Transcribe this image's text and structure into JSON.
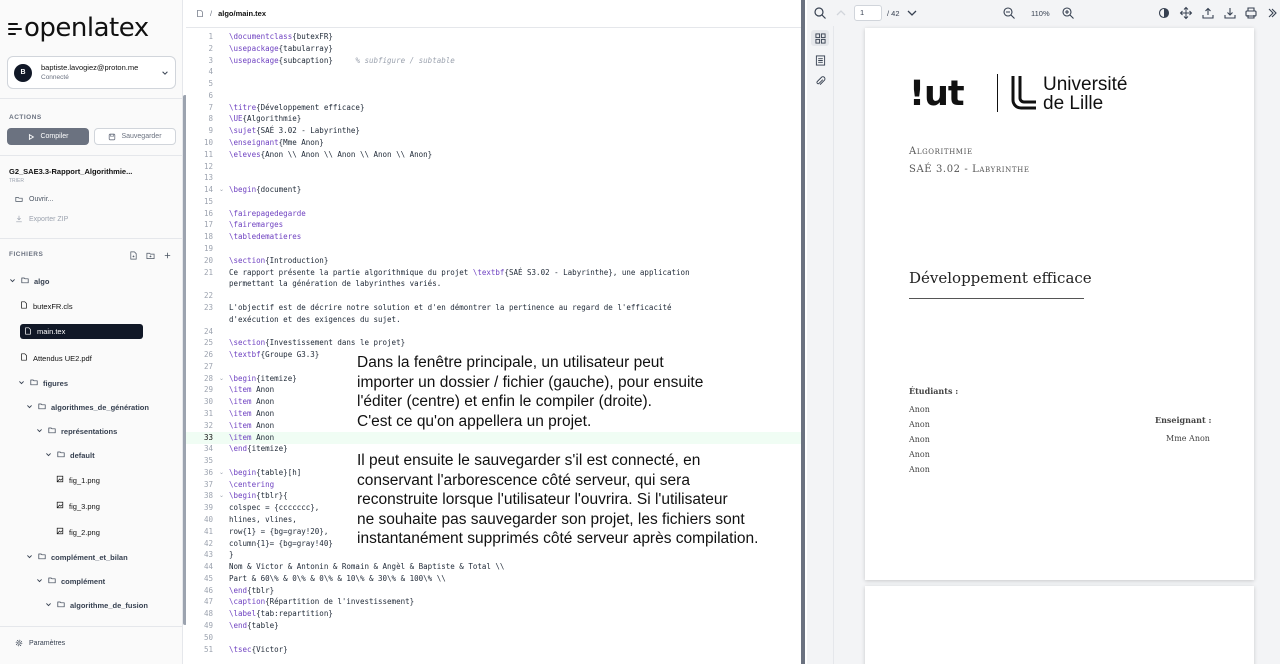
{
  "app": {
    "logo_text": "openlatex"
  },
  "account": {
    "initial": "B",
    "email": "baptiste.lavogiez@proton.me",
    "status": "Connecté"
  },
  "actions": {
    "label": "ACTIONS",
    "compile": "Compiler",
    "save": "Sauvegarder"
  },
  "project": {
    "name": "G2_SAE3.3-Rapport_Algorithmie...",
    "subtitle": "TRIER",
    "open": "Ouvrir...",
    "export": "Exporter ZIP"
  },
  "files": {
    "label": "FICHIERS",
    "tree": [
      {
        "name": "algo",
        "type": "dir"
      },
      {
        "name": "butexFR.cls",
        "type": "file"
      },
      {
        "name": "main.tex",
        "type": "file",
        "active": true
      },
      {
        "name": "Attendus UE2.pdf",
        "type": "file"
      },
      {
        "name": "figures",
        "type": "dir"
      },
      {
        "name": "algorithmes_de_génération",
        "type": "dir"
      },
      {
        "name": "représentations",
        "type": "dir"
      },
      {
        "name": "default",
        "type": "dir"
      },
      {
        "name": "fig_1.png",
        "type": "image"
      },
      {
        "name": "fig_3.png",
        "type": "image"
      },
      {
        "name": "fig_2.png",
        "type": "image"
      },
      {
        "name": "complément_et_bilan",
        "type": "dir"
      },
      {
        "name": "complément",
        "type": "dir"
      },
      {
        "name": "algorithme_de_fusion",
        "type": "dir"
      }
    ]
  },
  "settings": {
    "label": "Paramètres"
  },
  "editor": {
    "path_sep": "/",
    "path": "algo/main.tex",
    "current_line": "33",
    "lines": [
      {
        "n": "1",
        "t": "\\documentclass{butexFR}"
      },
      {
        "n": "2",
        "t": "\\usepackage{tabularray}"
      },
      {
        "n": "3",
        "t": "\\usepackage{subcaption}     % subfigure / subtable"
      },
      {
        "n": "4",
        "t": ""
      },
      {
        "n": "5",
        "t": ""
      },
      {
        "n": "6",
        "t": ""
      },
      {
        "n": "7",
        "t": "\\titre{Développement efficace}"
      },
      {
        "n": "8",
        "t": "\\UE{Algorithmie}"
      },
      {
        "n": "9",
        "t": "\\sujet{SAÉ 3.02 - Labyrinthe}"
      },
      {
        "n": "10",
        "t": "\\enseignant{Mme Anon}"
      },
      {
        "n": "11",
        "t": "\\eleves{Anon \\\\ Anon \\\\ Anon \\\\ Anon \\\\ Anon}"
      },
      {
        "n": "12",
        "t": ""
      },
      {
        "n": "13",
        "t": ""
      },
      {
        "n": "14",
        "t": "\\begin{document}"
      },
      {
        "n": "15",
        "t": ""
      },
      {
        "n": "16",
        "t": "\\fairepagedegarde"
      },
      {
        "n": "17",
        "t": "\\fairemarges"
      },
      {
        "n": "18",
        "t": "\\tabledematieres"
      },
      {
        "n": "19",
        "t": ""
      },
      {
        "n": "20",
        "t": "\\section{Introduction}"
      },
      {
        "n": "21",
        "t": "Ce rapport présente la partie algorithmique du projet \\textbf{SAÉ S3.02 - Labyrinthe}, une application"
      },
      {
        "n": "",
        "t": "permettant la génération de labyrinthes variés."
      },
      {
        "n": "22",
        "t": ""
      },
      {
        "n": "23",
        "t": "L'objectif est de décrire notre solution et d'en démontrer la pertinence au regard de l'efficacité"
      },
      {
        "n": "",
        "t": "d'exécution et des exigences du sujet."
      },
      {
        "n": "24",
        "t": ""
      },
      {
        "n": "25",
        "t": "\\section{Investissement dans le projet}"
      },
      {
        "n": "26",
        "t": "\\textbf{Groupe G3.3}"
      },
      {
        "n": "27",
        "t": ""
      },
      {
        "n": "28",
        "t": "\\begin{itemize}"
      },
      {
        "n": "29",
        "t": "\\item Anon"
      },
      {
        "n": "30",
        "t": "\\item Anon"
      },
      {
        "n": "31",
        "t": "\\item Anon"
      },
      {
        "n": "32",
        "t": "\\item Anon"
      },
      {
        "n": "33",
        "t": "\\item Anon"
      },
      {
        "n": "34",
        "t": "\\end{itemize}"
      },
      {
        "n": "35",
        "t": ""
      },
      {
        "n": "36",
        "t": "\\begin{table}[h]"
      },
      {
        "n": "37",
        "t": "\\centering"
      },
      {
        "n": "38",
        "t": "\\begin{tblr}{"
      },
      {
        "n": "39",
        "t": "colspec = {ccccccc},"
      },
      {
        "n": "40",
        "t": "hlines, vlines,"
      },
      {
        "n": "41",
        "t": "row{1} = {bg=gray!20},"
      },
      {
        "n": "42",
        "t": "column{1}= {bg=gray!40}"
      },
      {
        "n": "43",
        "t": "}"
      },
      {
        "n": "44",
        "t": "Nom & Victor & Antonin & Romain & Angèl & Baptiste & Total \\\\"
      },
      {
        "n": "45",
        "t": "Part & 60\\% & 0\\% & 0\\% & 10\\% & 30\\% & 100\\% \\\\"
      },
      {
        "n": "46",
        "t": "\\end{tblr}"
      },
      {
        "n": "47",
        "t": "\\caption{Répartition de l'investissement}"
      },
      {
        "n": "48",
        "t": "\\label{tab:repartition}"
      },
      {
        "n": "49",
        "t": "\\end{table}"
      },
      {
        "n": "50",
        "t": ""
      },
      {
        "n": "51",
        "t": "\\tsec{Victor}"
      }
    ]
  },
  "overlay": {
    "para1": "Dans la fenêtre principale, un utilisateur peut\nimporter un dossier / fichier (gauche), pour ensuite\nl'éditer (centre) et enfin le compiler (droite).\nC'est ce qu'on appellera un projet.",
    "para2": "Il peut ensuite le sauvegarder s'il est connecté, en\nconservant l'arborescence côté serveur, qui sera\nreconstruite lorsque l'utilisateur l'ouvrira. Si l'utilisateur\nne souhaite pas sauvegarder son projet, les fichiers sont\ninstantanément supprimés côté serveur après compilation."
  },
  "pdf": {
    "page": "1",
    "total": "/ 42",
    "zoom": "110%",
    "page1": {
      "logo_iut": "!ut",
      "logo_univ_line1": "Université",
      "logo_univ_line2": "de Lille",
      "ue": "Algorithmie",
      "sujet": "SAÉ 3.02 - Labyrinthe",
      "title": "Développement efficace",
      "students_label": "Étudiants :",
      "students": [
        "Anon",
        "Anon",
        "Anon",
        "Anon",
        "Anon"
      ],
      "teacher_label": "Enseignant :",
      "teacher": "Mme Anon"
    }
  },
  "colors": {
    "active_file_bg": "#111827",
    "latex_command": "#6f42c1",
    "current_line": "#f0fdf4"
  }
}
